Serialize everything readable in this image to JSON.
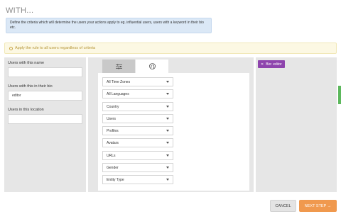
{
  "page": {
    "title": "WITH..."
  },
  "info": {
    "text": "Define the criteria which will determine the users your actions apply to eg. influential users, users with a keyword in their bio etc."
  },
  "rule": {
    "label": "Apply the rule to all users regardless of criteria"
  },
  "fields": [
    {
      "label": "Users with this name",
      "value": ""
    },
    {
      "label": "Users with this in their bio",
      "value": "editor"
    },
    {
      "label": "Users in this location",
      "value": ""
    }
  ],
  "tabs": {
    "filters_icon": "sliders-icon",
    "globe_icon": "globe-icon"
  },
  "selects": [
    "All Time Zones",
    "All Languages",
    "Country",
    "Users",
    "Profiles",
    "Avatars",
    "URLs",
    "Gender",
    "Entity Type"
  ],
  "tags": [
    {
      "label": "Bio: editor",
      "remove_icon": "close-icon"
    }
  ],
  "buttons": {
    "cancel": "CANCEL",
    "next": "NEXT STEP →"
  },
  "colors": {
    "info_bg": "#dbe8f6",
    "warning_bg": "#fcf8e3",
    "tag": "#8e44ad",
    "primary": "#f0994e",
    "side_tab": "#5cb85c"
  }
}
